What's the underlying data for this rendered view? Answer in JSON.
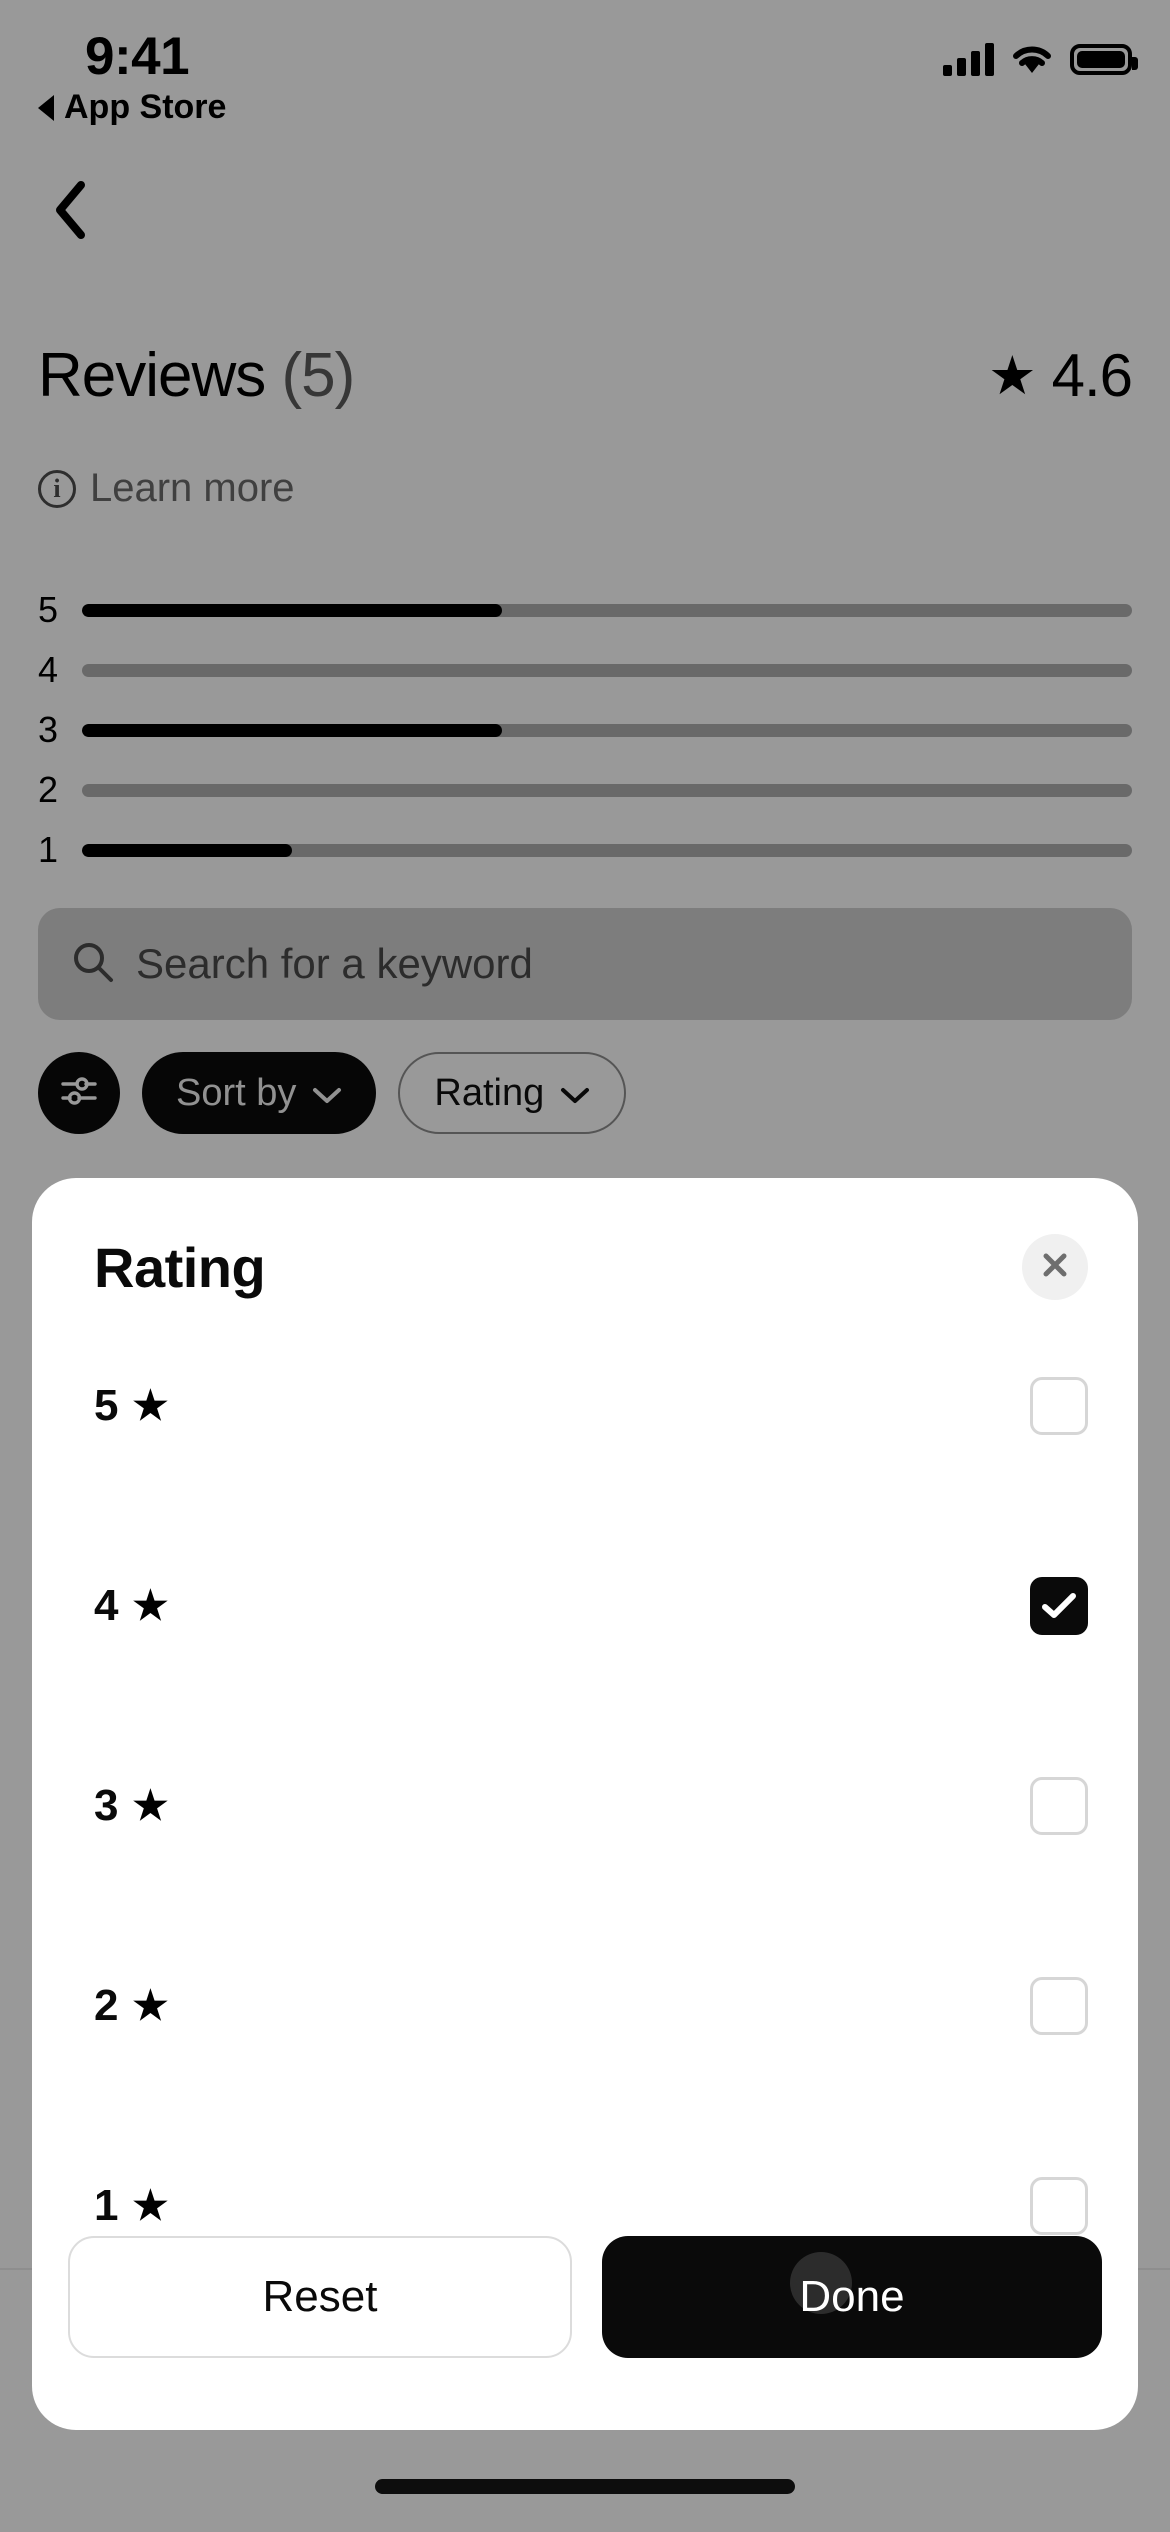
{
  "status_bar": {
    "time": "9:41",
    "back_app": "App Store",
    "icons": {
      "cellular": "signal-bars-icon",
      "wifi": "wifi-icon",
      "battery": "battery-full-icon"
    }
  },
  "nav": {
    "back_icon": "chevron-left-icon"
  },
  "reviews": {
    "title": "Reviews",
    "count": "(5)",
    "score": "4.6",
    "score_star_icon": "star-filled-icon",
    "learn_more": "Learn more",
    "learn_more_icon": "info-circle-icon"
  },
  "distribution": {
    "rows": [
      {
        "label": "5",
        "percent": 40
      },
      {
        "label": "4",
        "percent": 0
      },
      {
        "label": "3",
        "percent": 40
      },
      {
        "label": "2",
        "percent": 0
      },
      {
        "label": "1",
        "percent": 20
      }
    ]
  },
  "search": {
    "placeholder": "Search for a keyword",
    "value": "",
    "icon": "search-icon"
  },
  "filters": {
    "filter_icon": "sliders-icon",
    "sort_by": {
      "label": "Sort by",
      "chevron": "chevron-down-icon"
    },
    "rating": {
      "label": "Rating",
      "chevron": "chevron-down-icon"
    }
  },
  "modal": {
    "title": "Rating",
    "close_icon": "close-x-icon",
    "options": [
      {
        "value": "5",
        "star_icon": "star-filled-icon",
        "checked": false
      },
      {
        "value": "4",
        "star_icon": "star-filled-icon",
        "checked": true
      },
      {
        "value": "3",
        "star_icon": "star-filled-icon",
        "checked": false
      },
      {
        "value": "2",
        "star_icon": "star-filled-icon",
        "checked": false
      },
      {
        "value": "1",
        "star_icon": "star-filled-icon",
        "checked": false
      }
    ],
    "reset_label": "Reset",
    "done_label": "Done"
  },
  "colors": {
    "accent": "#0a0a0a",
    "track": "#b0b0b0",
    "muted_text": "#6b6b6b",
    "search_bg": "#d0d0d0",
    "checkbox_border": "#d6d6d6"
  },
  "glyphs": {
    "star": "★",
    "chevron_down": "⌄"
  }
}
